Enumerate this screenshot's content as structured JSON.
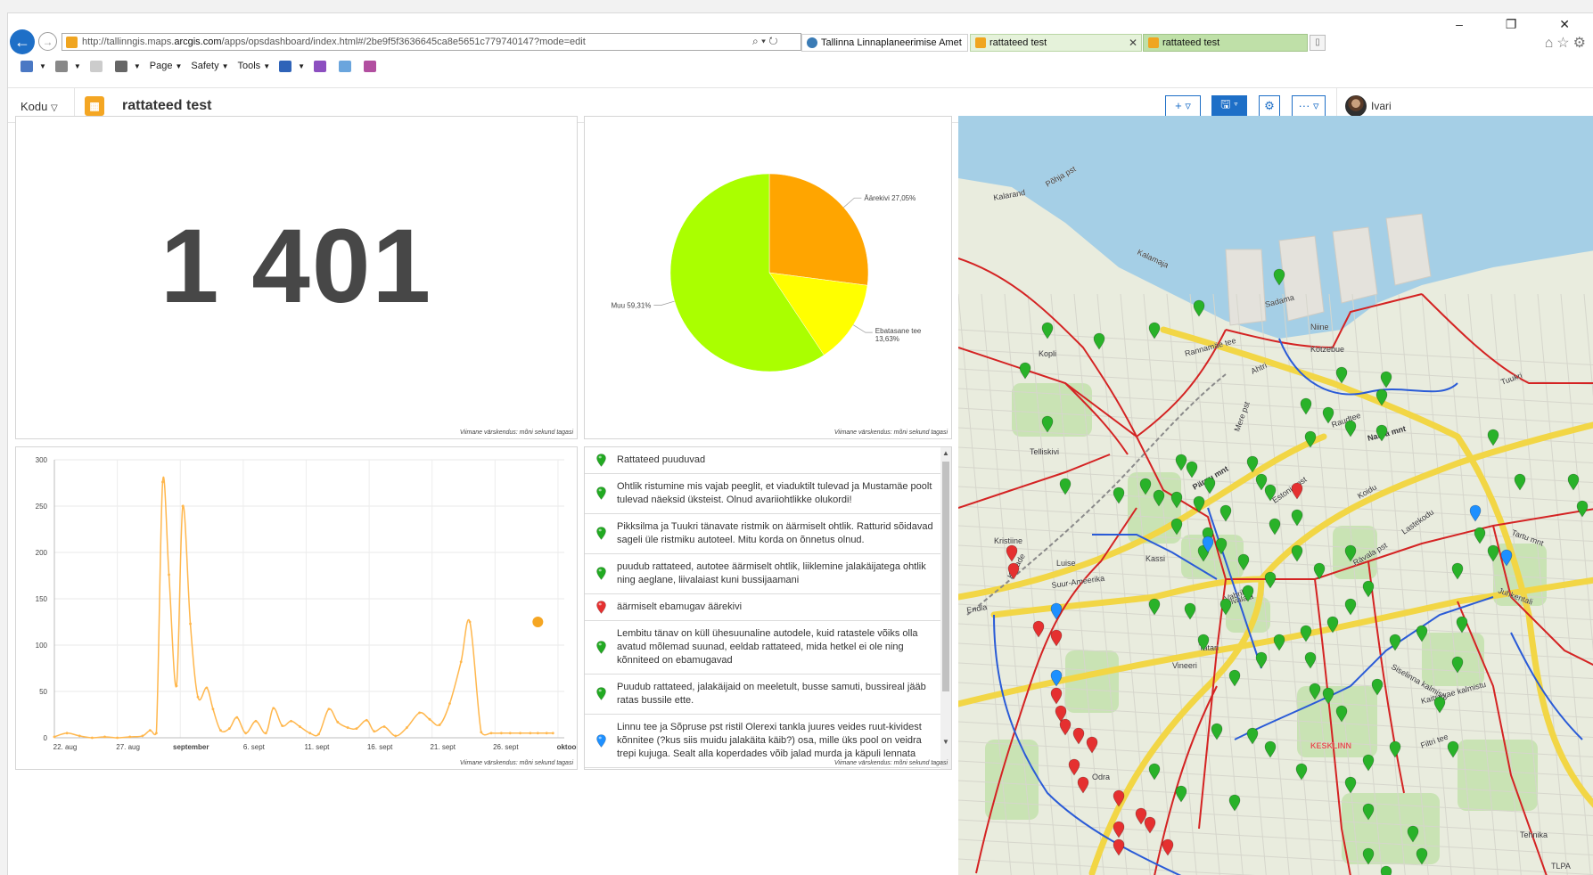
{
  "browser": {
    "url_prefix": "http://tallinngis.maps.",
    "url_host": "arcgis.com",
    "url_path": "/apps/opsdashboard/index.html#/2be9f5f3636645ca8e5651c779740147?mode=edit",
    "url_tools": "⌕ ▾ ↻",
    "tabs": [
      {
        "label": "Tallinna Linnaplaneerimise Amet",
        "color": "#3a7bb5"
      },
      {
        "label": "rattateed test",
        "color": "#f0a520"
      },
      {
        "label": "rattateed test",
        "color": "#f0a520"
      }
    ],
    "window_controls": "– ❐ ✕",
    "toolbar_icons": "⌂☆⚙",
    "commands": [
      {
        "label": "",
        "icon_color": "#4a78c4",
        "dropdown": true
      },
      {
        "label": "",
        "icon_color": "#888888",
        "dropdown": true
      },
      {
        "label": "",
        "icon_color": "#cccccc",
        "dropdown": false
      },
      {
        "label": "",
        "icon_color": "#666666",
        "dropdown": true
      },
      {
        "label": "Page",
        "icon_color": "",
        "dropdown": true
      },
      {
        "label": "Safety",
        "icon_color": "",
        "dropdown": true
      },
      {
        "label": "Tools",
        "icon_color": "",
        "dropdown": true
      },
      {
        "label": "",
        "icon_color": "#2f63b8",
        "dropdown": true
      },
      {
        "label": "",
        "icon_color": "#8c4fc0",
        "dropdown": false
      },
      {
        "label": "",
        "icon_color": "#6aa5dd",
        "dropdown": false
      },
      {
        "label": "",
        "icon_color": "#b24fa0",
        "dropdown": false
      }
    ]
  },
  "header": {
    "home_label": "Kodu",
    "title": "rattateed test",
    "add_label": "+ ▿",
    "save_label": "🖫 ▿",
    "settings_label": "⚙",
    "more_label": "··· ▿",
    "user_name": "Ivari"
  },
  "indicator": {
    "value": "1 401",
    "updated": "Viimane värskendus: mõni sekund tagasi"
  },
  "pie": {
    "updated": "Viimane värskendus: mõni sekund tagasi",
    "slices": [
      {
        "label": "Äärekivi 27,05%",
        "value": 27.05,
        "color": "#ffa500"
      },
      {
        "label_line1": "Ebatasane tee",
        "label_line2": "13,63%",
        "value": 13.63,
        "color": "#ffff00"
      },
      {
        "label": "Muu 59,31%",
        "value": 59.31,
        "color": "#aaff00"
      }
    ]
  },
  "line_chart": {
    "updated": "Viimane värskendus: mõni sekund tagasi"
  },
  "list": {
    "updated": "Viimane värskendus: mõni sekund tagasi",
    "items": [
      {
        "text": "Rattateed puuduvad",
        "color": "#22aa22"
      },
      {
        "text": "Ohtlik ristumine mis vajab peeglit, et viaduktilt tulevad ja Mustamäe poolt tulevad näeksid üksteist. Olnud avariiohtlikke olukordi!",
        "color": "#22aa22"
      },
      {
        "text": "Pikksilma ja Tuukri tänavate ristmik on äärmiselt ohtlik. Ratturid sõidavad sageli üle ristmiku autoteel. Mitu korda on õnnetus olnud.",
        "color": "#22aa22"
      },
      {
        "text": "puudub rattateed, autotee äärmiselt ohtlik, liiklemine jalakäijatega ohtlik ning aeglane, liivalaiast kuni bussijaamani",
        "color": "#22aa22"
      },
      {
        "text": "äärmiselt ebamugav äärekivi",
        "color": "#e53030"
      },
      {
        "text": "Lembitu tänav on küll ühesuunaline autodele, kuid ratastele võiks olla avatud mõlemad suunad, eeldab rattateed, mida hetkel ei ole ning kõnniteed on ebamugavad",
        "color": "#22aa22"
      },
      {
        "text": "Puudub rattateed, jalakäijaid on meeletult, busse samuti, bussireal jääb ratas bussile ette.",
        "color": "#22aa22"
      },
      {
        "text": "Linnu tee ja Sõpruse pst ristil Olerexi tankla juures veides ruut-kividest kõnnitee (?kus siis muidu jalakäita käib?) osa, mille üks pool on veidra trepi kujuga. Sealt alla koperdades võib jalad murda ja käpuli lennata",
        "color": "#1e90ff"
      }
    ]
  },
  "map": {
    "labels": [
      "Kalarand",
      "Põhja pst",
      "Kalamaja",
      "Niine",
      "Kotzebue",
      "Rannamäe tee",
      "Kopli",
      "Telliskivi",
      "Narva mnt",
      "Tuukri",
      "Pärnu mnt",
      "Estonia pst",
      "Endla",
      "Suur-Ameerika",
      "Liivalaia",
      "Kristiine",
      "Tatari",
      "Vineeri",
      "Siselinna kalmistu",
      "Kaitsevae kalmistu",
      "KESKLINN",
      "TLPA",
      "Tehnika",
      "Juhkentali",
      "Tartu mnt",
      "Ahtri",
      "Mere pst",
      "Sadama",
      "Vabriku",
      "Raudtee",
      "Kassi",
      "Luise",
      "Kevade",
      "Rävala pst",
      "Lastekodu",
      "Koidu",
      "Filtri tee",
      "Odra"
    ]
  },
  "chart_data": [
    {
      "type": "pie",
      "title": "",
      "slices": [
        {
          "label": "Äärekivi",
          "value": 27.05
        },
        {
          "label": "Ebatasane tee",
          "value": 13.63
        },
        {
          "label": "Muu",
          "value": 59.31
        }
      ]
    },
    {
      "type": "line",
      "title": "",
      "xlabel": "",
      "ylabel": "",
      "ylim": [
        0,
        300
      ],
      "yticks": [
        0,
        50,
        100,
        150,
        200,
        250,
        300
      ],
      "xtick_labels": [
        "22. aug",
        "27. aug",
        "september",
        "6. sept",
        "11. sept",
        "16. sept",
        "21. sept",
        "26. sept",
        "oktoob"
      ],
      "xtick_day_index": [
        0,
        5,
        10,
        15,
        20,
        25,
        30,
        35,
        40
      ],
      "series": [
        {
          "color": "#ffb74d",
          "x": [
            0,
            1,
            2,
            3,
            4,
            5,
            6,
            7,
            7.6,
            8.1,
            8.6,
            9.1,
            9.7,
            10.2,
            10.8,
            11.4,
            12.1,
            12.6,
            13.2,
            13.9,
            14.5,
            15.2,
            16,
            16.8,
            17.4,
            18.1,
            18.8,
            19.5,
            20.3,
            21,
            21.8,
            22.5,
            23.3,
            24,
            24.8,
            25.4,
            26.2,
            27.1,
            28,
            29,
            29.8,
            30.6,
            31.4,
            32.3,
            33,
            33.9,
            34.7,
            35.5,
            36.2,
            37,
            37.8,
            38.4,
            39.1,
            39.6
          ],
          "y": [
            1,
            5,
            2,
            0,
            1,
            0,
            1,
            2,
            8,
            5,
            276,
            176,
            56,
            250,
            123,
            44,
            54,
            31,
            8,
            10,
            22,
            5,
            18,
            5,
            32,
            13,
            18,
            12,
            5,
            4,
            31,
            17,
            11,
            10,
            19,
            7,
            12,
            2,
            11,
            27,
            20,
            14,
            37,
            82,
            125,
            6,
            5,
            5,
            5,
            5,
            5,
            5,
            5,
            5
          ],
          "highlight_point": {
            "x": 38.4,
            "y": 125
          }
        }
      ]
    }
  ]
}
